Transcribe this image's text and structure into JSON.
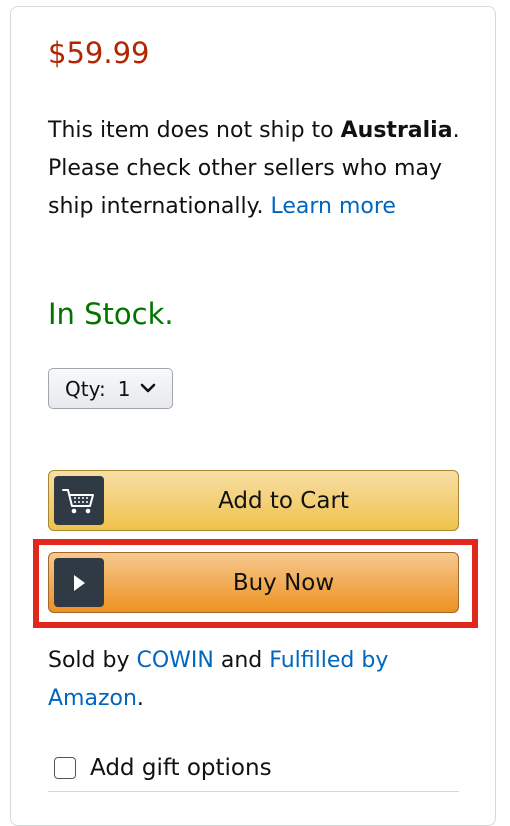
{
  "price": "$59.99",
  "shipping": {
    "text_before": "This item does not ship to ",
    "country": "Australia",
    "text_after": ". Please check other sellers who may ship internationally. ",
    "learn_more": "Learn more"
  },
  "stock_status": "In Stock.",
  "quantity": {
    "label": "Qty:",
    "value": "1"
  },
  "buttons": {
    "add_to_cart": "Add to Cart",
    "buy_now": "Buy Now"
  },
  "sold_by": {
    "prefix": "Sold by ",
    "seller": "COWIN",
    "middle": " and ",
    "fulfilled": "Fulfilled by Amazon",
    "suffix": "."
  },
  "gift_option": {
    "label": "Add gift options",
    "checked": false
  },
  "colors": {
    "price": "#b12704",
    "in_stock": "#007600",
    "link": "#0066c0",
    "highlight": "#e0281c",
    "add_to_cart": "#f0c14b",
    "buy_now": "#ed9220"
  },
  "icons": {
    "cart": "shopping-cart-icon",
    "buy_now": "play-icon",
    "qty_dropdown": "chevron-down-icon"
  }
}
